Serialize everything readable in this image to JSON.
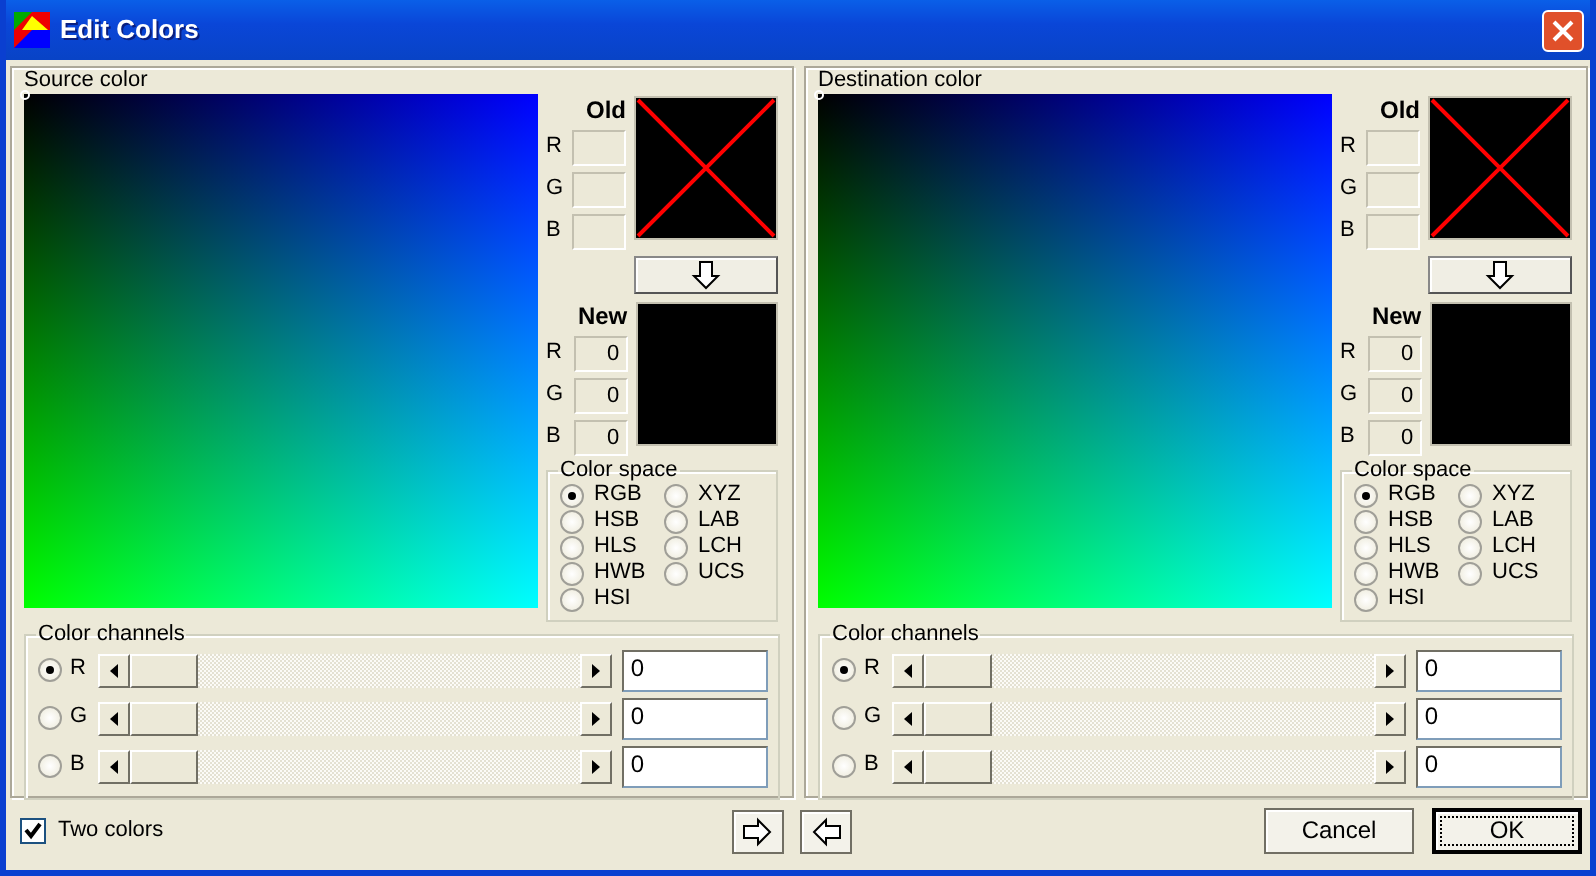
{
  "window": {
    "title": "Edit Colors"
  },
  "panels": [
    {
      "title": "Source color",
      "old": {
        "label": "Old",
        "crossed": true,
        "channels": [
          {
            "label": "R"
          },
          {
            "label": "G"
          },
          {
            "label": "B"
          }
        ]
      },
      "new": {
        "label": "New",
        "crossed": false,
        "channels": [
          {
            "label": "R",
            "value": "0"
          },
          {
            "label": "G",
            "value": "0"
          },
          {
            "label": "B",
            "value": "0"
          }
        ]
      },
      "color_space": {
        "title": "Color space",
        "options": [
          {
            "label": "RGB",
            "selected": true
          },
          {
            "label": "HSB",
            "selected": false
          },
          {
            "label": "HLS",
            "selected": false
          },
          {
            "label": "HWB",
            "selected": false
          },
          {
            "label": "HSI",
            "selected": false
          },
          {
            "label": "XYZ",
            "selected": false
          },
          {
            "label": "LAB",
            "selected": false
          },
          {
            "label": "LCH",
            "selected": false
          },
          {
            "label": "UCS",
            "selected": false
          }
        ]
      },
      "channels": {
        "title": "Color channels",
        "items": [
          {
            "label": "R",
            "selected": true,
            "value": "0"
          },
          {
            "label": "G",
            "selected": false,
            "value": "0"
          },
          {
            "label": "B",
            "selected": false,
            "value": "0"
          }
        ]
      }
    },
    {
      "title": "Destination color",
      "old": {
        "label": "Old",
        "crossed": true,
        "channels": [
          {
            "label": "R"
          },
          {
            "label": "G"
          },
          {
            "label": "B"
          }
        ]
      },
      "new": {
        "label": "New",
        "crossed": false,
        "channels": [
          {
            "label": "R",
            "value": "0"
          },
          {
            "label": "G",
            "value": "0"
          },
          {
            "label": "B",
            "value": "0"
          }
        ]
      },
      "color_space": {
        "title": "Color space",
        "options": [
          {
            "label": "RGB",
            "selected": true
          },
          {
            "label": "HSB",
            "selected": false
          },
          {
            "label": "HLS",
            "selected": false
          },
          {
            "label": "HWB",
            "selected": false
          },
          {
            "label": "HSI",
            "selected": false
          },
          {
            "label": "XYZ",
            "selected": false
          },
          {
            "label": "LAB",
            "selected": false
          },
          {
            "label": "LCH",
            "selected": false
          },
          {
            "label": "UCS",
            "selected": false
          }
        ]
      },
      "channels": {
        "title": "Color channels",
        "items": [
          {
            "label": "R",
            "selected": true,
            "value": "0"
          },
          {
            "label": "G",
            "selected": false,
            "value": "0"
          },
          {
            "label": "B",
            "selected": false,
            "value": "0"
          }
        ]
      }
    }
  ],
  "two_colors": {
    "label": "Two colors",
    "checked": true
  },
  "buttons": [
    {
      "label": "Cancel",
      "default": false
    },
    {
      "label": "OK",
      "default": true
    }
  ]
}
